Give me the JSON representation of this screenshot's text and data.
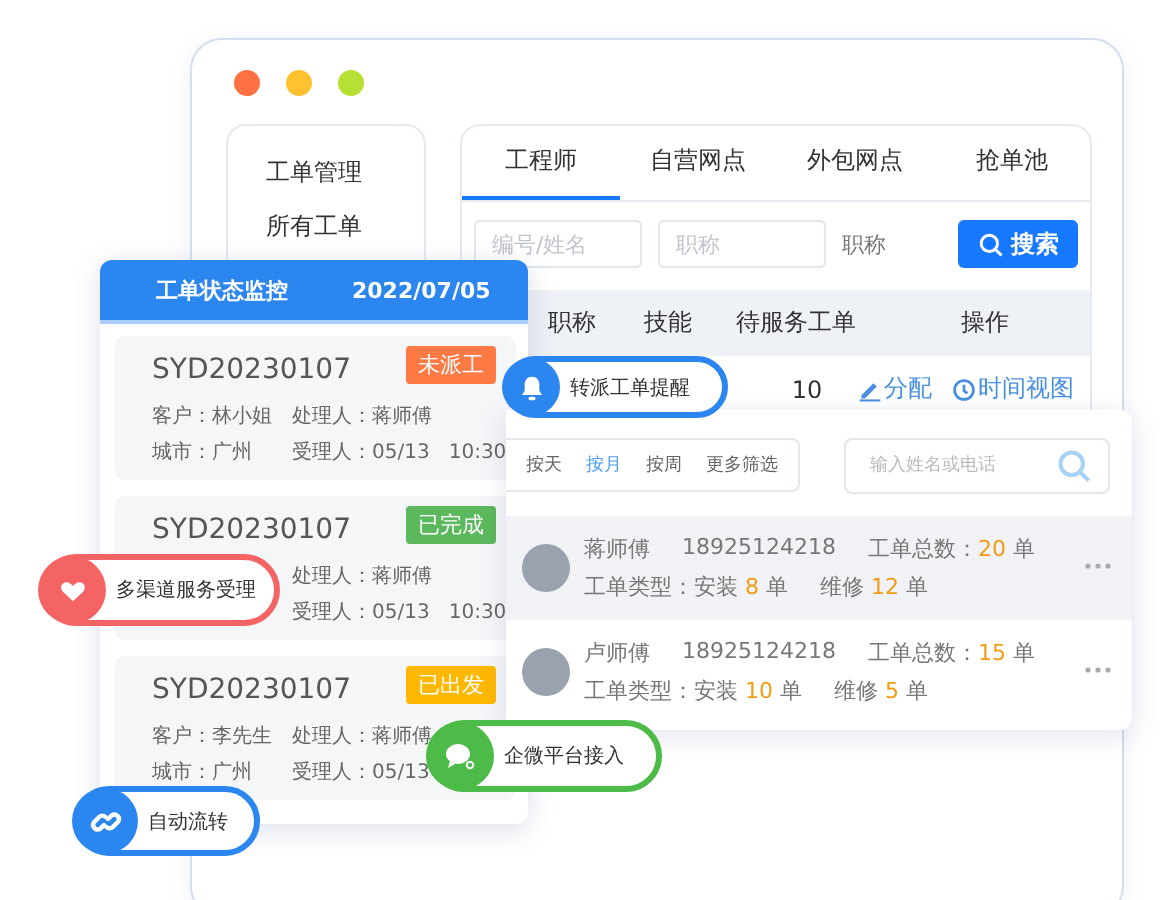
{
  "window": {
    "controls": [
      {
        "color": "#ff7043"
      },
      {
        "color": "#ffc12f"
      },
      {
        "color": "#b6e033"
      }
    ]
  },
  "sidebar": {
    "items": [
      {
        "label": "工单管理",
        "selected": false
      },
      {
        "label": "所有工单",
        "selected": false
      }
    ]
  },
  "tabs": [
    {
      "label": "工程师",
      "selected": true
    },
    {
      "label": "自营网点",
      "selected": false
    },
    {
      "label": "外包网点",
      "selected": false
    },
    {
      "label": "抢单池",
      "selected": false
    }
  ],
  "filters": {
    "fields": [
      {
        "placeholder": "编号/姓名"
      },
      {
        "placeholder": "职称"
      }
    ],
    "label": "职称",
    "search_button": "搜索"
  },
  "table": {
    "columns": [
      "职称",
      "技能",
      "待服务工单",
      "操作"
    ],
    "rows": [
      {
        "pending": "10",
        "actions": [
          {
            "kind": "edit",
            "label": "分配"
          },
          {
            "kind": "clock",
            "label": "时间视图"
          }
        ]
      }
    ]
  },
  "monitor": {
    "title": "工单状态监控",
    "date": "2022/07/05",
    "orders": [
      {
        "id": "SYD20230107",
        "status": {
          "label": "未派工",
          "color": "#ff7a45"
        },
        "customer": "客户：林小姐",
        "handler": "处理人：蒋师傅",
        "city": "城市：广州",
        "acceptor": "受理人：05/13   10:30"
      },
      {
        "id": "SYD20230107",
        "status": {
          "label": "已完成",
          "color": "#5cb85c"
        },
        "handler": "处理人：蒋师傅",
        "acceptor": "受理人：05/13   10:30"
      },
      {
        "id": "SYD20230107",
        "status": {
          "label": "已出发",
          "color": "#ffb800"
        },
        "customer": "客户：李先生",
        "handler": "处理人：蒋师傅",
        "city": "城市：广州",
        "acceptor": "受理人：05/13"
      }
    ]
  },
  "technicians": {
    "periods": [
      {
        "label": "按天",
        "selected": false
      },
      {
        "label": "按月",
        "selected": true
      },
      {
        "label": "按周",
        "selected": false
      },
      {
        "label": "更多筛选",
        "selected": false
      }
    ],
    "search": {
      "placeholder": "输入姓名或电话"
    },
    "items": [
      {
        "name": "蒋师傅",
        "phone": "18925124218",
        "total_label": "工单总数：",
        "total": "20",
        "total_unit": "单",
        "type_label": "工单类型：",
        "install_label": "安装",
        "install": "8",
        "install_unit": "单",
        "repair_label": "维修",
        "repair": "12",
        "repair_unit": "单",
        "selected": true
      },
      {
        "name": "卢师傅",
        "phone": "18925124218",
        "total_label": "工单总数：",
        "total": "15",
        "total_unit": "单",
        "type_label": "工单类型：",
        "install_label": "安装",
        "install": "10",
        "install_unit": "单",
        "repair_label": "维修",
        "repair": "5",
        "repair_unit": "单",
        "selected": false
      }
    ]
  },
  "badges": [
    {
      "kind": "bell",
      "label": "转派工单提醒",
      "color": "#2b86f0"
    },
    {
      "kind": "heart",
      "label": "多渠道服务受理",
      "color": "#f56464"
    },
    {
      "kind": "chat",
      "label": "企微平台接入",
      "color": "#4dbb47"
    },
    {
      "kind": "link",
      "label": "自动流转",
      "color": "#2b86f0"
    }
  ]
}
